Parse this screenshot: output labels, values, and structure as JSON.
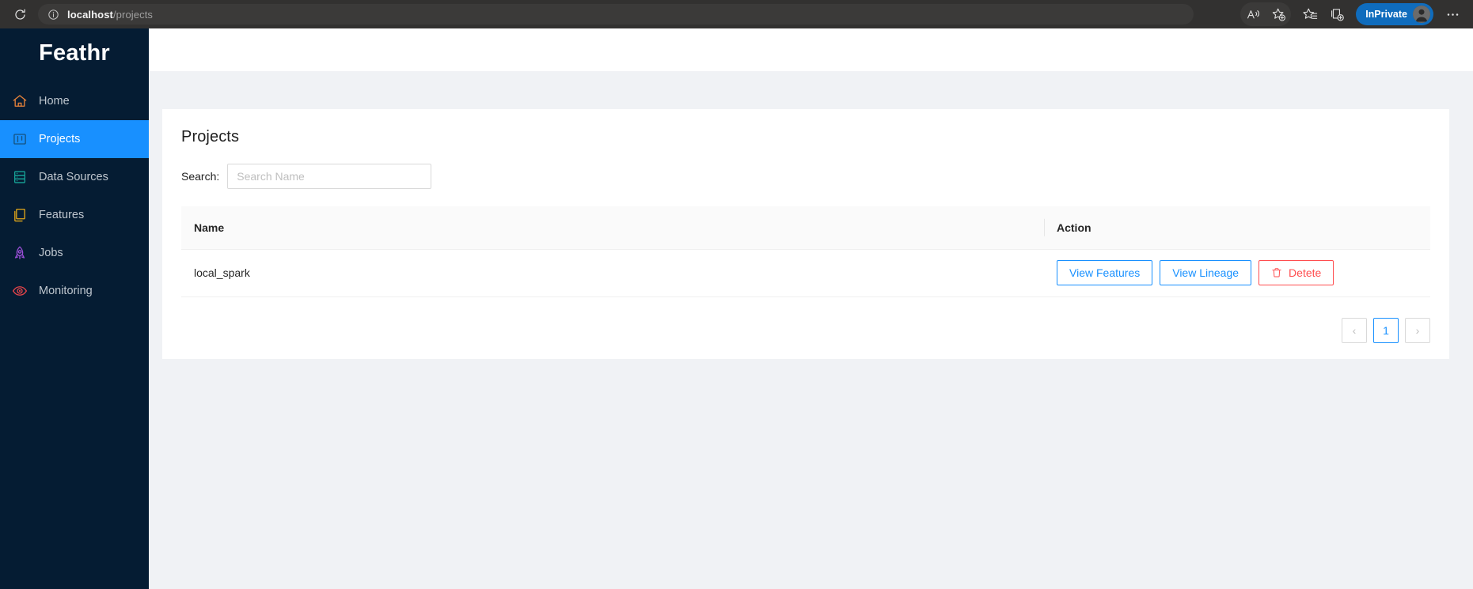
{
  "browser": {
    "reload_icon": "reload-icon",
    "site_info_icon": "site-info-icon",
    "url_host": "localhost",
    "url_path": "/projects",
    "toolbar_icons": [
      {
        "name": "read-aloud-icon"
      },
      {
        "name": "add-favorite-icon"
      },
      {
        "name": "favorites-icon"
      },
      {
        "name": "collections-icon"
      }
    ],
    "inprivate_label": "InPrivate",
    "profile_icon": "avatar-icon",
    "settings_more_icon": "more-options-icon"
  },
  "sidebar": {
    "brand": "Feathr",
    "items": [
      {
        "label": "Home",
        "icon": "home-icon",
        "active": false
      },
      {
        "label": "Projects",
        "icon": "projects-icon",
        "active": true
      },
      {
        "label": "Data Sources",
        "icon": "database-icon",
        "active": false
      },
      {
        "label": "Features",
        "icon": "features-icon",
        "active": false
      },
      {
        "label": "Jobs",
        "icon": "rocket-icon",
        "active": false
      },
      {
        "label": "Monitoring",
        "icon": "eye-icon",
        "active": false
      }
    ]
  },
  "main": {
    "page_title": "Projects",
    "search": {
      "label": "Search:",
      "placeholder": "Search Name",
      "value": ""
    },
    "table": {
      "columns": [
        "Name",
        "Action"
      ],
      "rows": [
        {
          "name": "local_spark",
          "actions": [
            {
              "label": "View Features",
              "style": "primary-ghost"
            },
            {
              "label": "View Lineage",
              "style": "primary-ghost"
            },
            {
              "label": "Detete",
              "style": "danger-ghost",
              "icon": "trash-icon"
            }
          ]
        }
      ]
    },
    "pagination": {
      "prev_label": "‹",
      "next_label": "›",
      "pages": [
        "1"
      ],
      "current_page": "1"
    }
  },
  "colors": {
    "sidebar_bg": "#051c33",
    "accent_blue": "#1890ff",
    "danger_red": "#ff4d4f",
    "page_bg": "#f0f2f5",
    "inprivate_blue": "#0f6cbd"
  }
}
